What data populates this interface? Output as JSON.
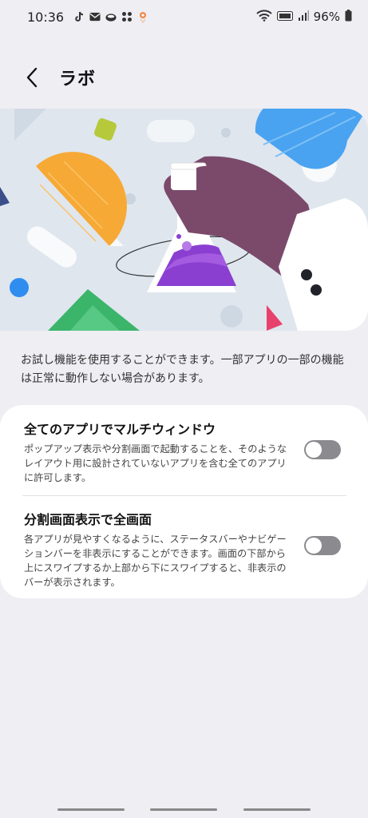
{
  "status_bar": {
    "time": "10:36",
    "battery": "96%",
    "notification_icons": [
      "tiktok-icon",
      "mail-icon",
      "app-icon",
      "dots-icon",
      "location-pin-icon"
    ]
  },
  "header": {
    "back_icon": "chevron-left-icon",
    "title": "ラボ"
  },
  "description": "お試し機能を使用することができます。一部アプリの一部の機能は正常に動作しない場合があります。",
  "settings": [
    {
      "title": "全てのアプリでマルチウィンドウ",
      "subtitle": "ポップアップ表示や分割画面で起動することを、そのようなレイアウト用に設計されていないアプリを含む全てのアプリに許可します。",
      "enabled": false
    },
    {
      "title": "分割画面表示で全画面",
      "subtitle": "各アプリが見やすくなるように、ステータスバーやナビゲーションバーを非表示にすることができます。画面の下部から上にスワイプするか上部から下にスワイプすると、非表示のバーが表示されます。",
      "enabled": false
    }
  ],
  "colors": {
    "background": "#eeeef3",
    "card": "#ffffff",
    "toggle_off": "#8b8b8f",
    "flask_liquid": "#8a3fd1",
    "arm": "#7b4a6b"
  }
}
